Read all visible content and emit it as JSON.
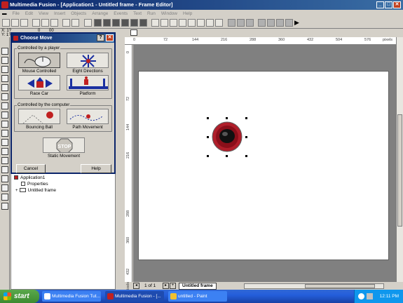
{
  "window": {
    "title": "Multimedia Fusion - [Application1 - Untitled frame - Frame Editor]",
    "minimize": "_",
    "maximize": "□",
    "close": "✕"
  },
  "menu": [
    "File",
    "Edit",
    "View",
    "Insert",
    "Objects",
    "Arrange",
    "Events",
    "Text",
    "Run",
    "Window",
    "Help"
  ],
  "coords": {
    "x": "X: 1?",
    "y": "Y: 1?",
    "num": "0",
    "num2": "00"
  },
  "dialog": {
    "title": "Choose Move",
    "help_glyph": "?",
    "close_glyph": "✕",
    "group_player": "Controlled by a player",
    "group_computer": "Controlled by the computer",
    "options": {
      "mouse": "Mouse Controlled",
      "eight": "Eight Directions",
      "race": "Race Car",
      "platform": "Platform",
      "bouncing": "Bouncing Ball",
      "path": "Path Movement",
      "static": "Static Movement"
    },
    "stop_sign": "STOP",
    "cancel": "Cancel",
    "help": "Help"
  },
  "tree": {
    "app": "Application1",
    "properties": "Properties",
    "frame": "Untitled frame"
  },
  "ruler": {
    "top": [
      "0",
      "72",
      "144",
      "216",
      "288",
      "360",
      "432",
      "504",
      "576"
    ],
    "top_unit": "pixels",
    "left": [
      "0",
      "72",
      "144",
      "216",
      "288",
      "360",
      "432"
    ],
    "left_unit": "pixels"
  },
  "frame_nav": {
    "page": "1 of 1",
    "tab": "Untitled frame"
  },
  "taskbar": {
    "start": "start",
    "tasks": [
      "Multimedia Fusion Tut...",
      "Multimedia Fusion - [...",
      "untitled - Paint"
    ],
    "clock": "12:11 PM"
  }
}
